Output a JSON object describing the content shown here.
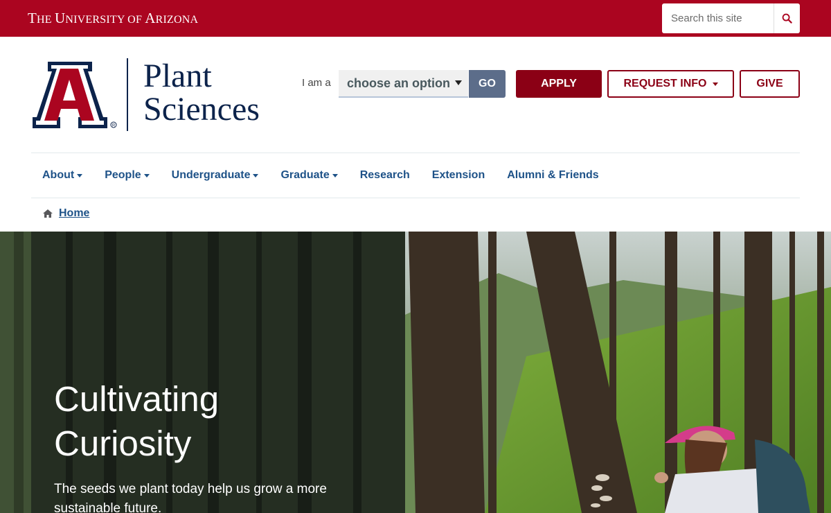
{
  "utility": {
    "university_name": {
      "p1_big": "T",
      "p1_sc": "HE ",
      "p2_big": "U",
      "p2_sc": "NIVERSITY OF ",
      "p3_big": "A",
      "p3_sc": "RIZONA"
    },
    "search_placeholder": "Search this site",
    "search_icon": "search-icon"
  },
  "brand": {
    "logo": "block-a-logo",
    "site_name_line1": "Plant",
    "site_name_line2": "Sciences",
    "colors": {
      "red": "#ab0520",
      "navy": "#0c234b",
      "blue": "#1e5288",
      "dark_red": "#8b0015"
    }
  },
  "audience": {
    "label": "I am a",
    "select_value": "choose an option",
    "go_label": "GO"
  },
  "actions": {
    "apply_label": "APPLY",
    "request_label": "REQUEST INFO",
    "give_label": "GIVE"
  },
  "nav": {
    "items": [
      {
        "label": "About",
        "dropdown": true
      },
      {
        "label": "People",
        "dropdown": true
      },
      {
        "label": "Undergraduate",
        "dropdown": true
      },
      {
        "label": "Graduate",
        "dropdown": true
      },
      {
        "label": "Research",
        "dropdown": false
      },
      {
        "label": "Extension",
        "dropdown": false
      },
      {
        "label": "Alumni & Friends",
        "dropdown": false
      }
    ]
  },
  "breadcrumb": {
    "icon": "home-icon",
    "home_label": "Home"
  },
  "hero": {
    "title_line1": "Cultivating",
    "title_line2": "Curiosity",
    "subtitle": "The seeds we plant today help us grow a more sustainable future."
  }
}
